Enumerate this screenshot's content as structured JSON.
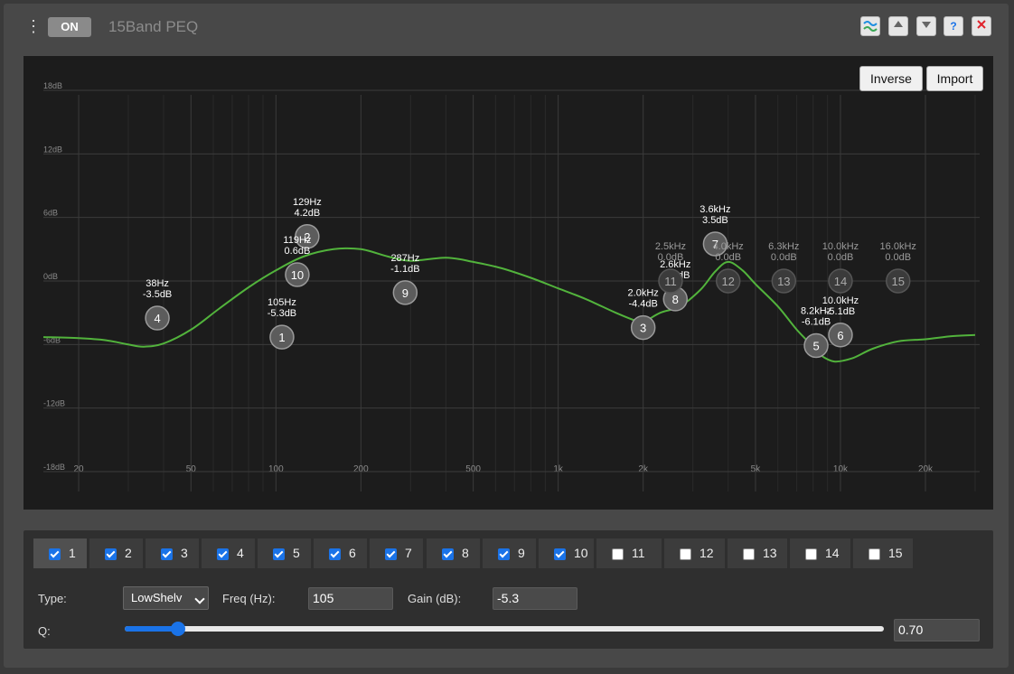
{
  "header": {
    "on_label": "ON",
    "title": "15Band PEQ",
    "menu_icon": "vertical-ellipsis-icon",
    "icons": [
      "wave-icon",
      "arrow-up-icon",
      "arrow-down-icon",
      "help-icon",
      "close-icon"
    ],
    "help_glyph": "?"
  },
  "graph_buttons": {
    "inverse": "Inverse",
    "import": "Import"
  },
  "chart_data": {
    "type": "line",
    "x_scale": "log",
    "xlim": [
      15,
      30000
    ],
    "ylim": [
      -18,
      18
    ],
    "y_ticks": [
      "18dB",
      "12dB",
      "6dB",
      "0dB",
      "-6dB",
      "-12dB",
      "-18dB"
    ],
    "x_ticks": [
      "20",
      "50",
      "100",
      "200",
      "500",
      "1k",
      "2k",
      "5k",
      "10k",
      "20k"
    ],
    "grid": true,
    "colors": {
      "curve": "#52b33c",
      "grid": "#3b3b3b",
      "active_handle": "#5c5c5c",
      "inactive_handle": "#3b3b3b"
    },
    "series": [
      {
        "x": [
          15,
          20,
          25,
          30,
          34,
          40,
          50,
          63,
          80,
          100,
          125,
          160,
          200,
          250,
          300,
          400,
          500,
          630,
          800,
          1000,
          1250,
          1600,
          1900,
          2000,
          2300,
          2700,
          3200,
          3600,
          4000,
          4500,
          5000,
          6000,
          7000,
          8000,
          8500,
          9500,
          11000,
          13000,
          16000,
          20000,
          25000,
          30000
        ],
        "values": [
          -5.3,
          -5.4,
          -5.6,
          -6.0,
          -6.2,
          -5.9,
          -4.6,
          -2.6,
          -0.6,
          1.0,
          2.3,
          3.0,
          3.0,
          2.3,
          1.9,
          2.2,
          1.8,
          1.2,
          0.3,
          -0.7,
          -1.7,
          -3.0,
          -3.8,
          -3.9,
          -3.0,
          -2.4,
          -0.8,
          0.9,
          1.8,
          1.0,
          -0.3,
          -2.4,
          -4.6,
          -6.2,
          -7.0,
          -7.6,
          -7.3,
          -6.4,
          -5.7,
          -5.5,
          -5.2,
          -5.1
        ]
      }
    ],
    "bands": [
      {
        "n": "1",
        "freq": "105Hz",
        "gain": "-5.3dB",
        "f": 105,
        "g": -5.3,
        "active": true
      },
      {
        "n": "2",
        "freq": "129Hz",
        "gain": "4.2dB",
        "f": 129,
        "g": 4.2,
        "active": true
      },
      {
        "n": "3",
        "freq": "2.0kHz",
        "gain": "-4.4dB",
        "f": 2000,
        "g": -4.4,
        "active": true
      },
      {
        "n": "4",
        "freq": "38Hz",
        "gain": "-3.5dB",
        "f": 38,
        "g": -3.5,
        "active": true
      },
      {
        "n": "5",
        "freq": "8.2kHz",
        "gain": "-6.1dB",
        "f": 8200,
        "g": -6.1,
        "active": true
      },
      {
        "n": "6",
        "freq": "10.0kHz",
        "gain": "-5.1dB",
        "f": 10000,
        "g": -5.1,
        "active": true
      },
      {
        "n": "7",
        "freq": "3.6kHz",
        "gain": "3.5dB",
        "f": 3600,
        "g": 3.5,
        "active": true
      },
      {
        "n": "8",
        "freq": "2.6kHz",
        "gain": "-1.7dB",
        "f": 2600,
        "g": -1.7,
        "active": true
      },
      {
        "n": "9",
        "freq": "287Hz",
        "gain": "-1.1dB",
        "f": 287,
        "g": -1.1,
        "active": true
      },
      {
        "n": "10",
        "freq": "119Hz",
        "gain": "0.6dB",
        "f": 119,
        "g": 0.6,
        "active": true
      },
      {
        "n": "11",
        "freq": "2.5kHz",
        "gain": "0.0dB",
        "f": 2500,
        "g": 0.0,
        "active": false
      },
      {
        "n": "12",
        "freq": "4.0kHz",
        "gain": "0.0dB",
        "f": 4000,
        "g": 0.0,
        "active": false
      },
      {
        "n": "13",
        "freq": "6.3kHz",
        "gain": "0.0dB",
        "f": 6300,
        "g": 0.0,
        "active": false
      },
      {
        "n": "14",
        "freq": "10.0kHz",
        "gain": "0.0dB",
        "f": 10000,
        "g": 0.0,
        "active": false
      },
      {
        "n": "15",
        "freq": "16.0kHz",
        "gain": "0.0dB",
        "f": 16000,
        "g": 0.0,
        "active": false
      }
    ]
  },
  "tabs": [
    {
      "label": "1",
      "checked": true,
      "selected": true
    },
    {
      "label": "2",
      "checked": true
    },
    {
      "label": "3",
      "checked": true
    },
    {
      "label": "4",
      "checked": true
    },
    {
      "label": "5",
      "checked": true
    },
    {
      "label": "6",
      "checked": true
    },
    {
      "label": "7",
      "checked": true
    },
    {
      "label": "8",
      "checked": true
    },
    {
      "label": "9",
      "checked": true
    },
    {
      "label": "10",
      "checked": true
    },
    {
      "label": "11",
      "checked": false
    },
    {
      "label": "12",
      "checked": false
    },
    {
      "label": "13",
      "checked": false
    },
    {
      "label": "14",
      "checked": false
    },
    {
      "label": "15",
      "checked": false
    }
  ],
  "controls": {
    "type_label": "Type:",
    "type_value": "LowShelv",
    "freq_label": "Freq (Hz):",
    "freq_value": "105",
    "gain_label": "Gain (dB):",
    "gain_value": "-5.3",
    "q_label": "Q:",
    "q_value": "0.70",
    "q_slider_fraction": 0.07
  }
}
